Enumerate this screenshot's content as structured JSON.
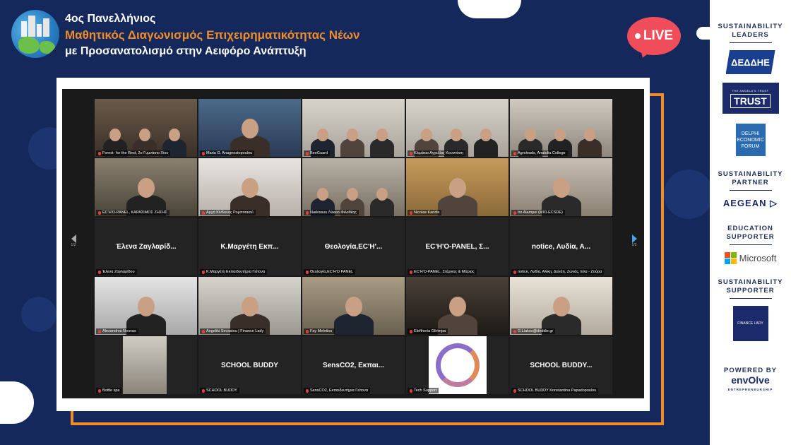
{
  "header": {
    "line1": "4ος Πανελλήνιος",
    "line2": "Μαθητικός Διαγωνισμός Επιχειρηματικότητας Νέων",
    "line3": "με Προσανατολισμό στην Αειφόρο Ανάπτυξη"
  },
  "live_badge": "LIVE",
  "zoom": {
    "page_left": "1/2",
    "page_right": "1/2",
    "tiles": [
      {
        "name": "Forest- for the Rest, 2ο Γυμνάσιο Χίου",
        "type": "video",
        "scene": "classroom"
      },
      {
        "name": "Maria G. Anagnostopoulou",
        "type": "video",
        "scene": "envolve-stage"
      },
      {
        "name": "BeeGuard",
        "type": "video",
        "scene": "group",
        "active": true
      },
      {
        "name": "Κλιμάκιο Αγγελίας Κουστάση",
        "type": "video",
        "scene": "group"
      },
      {
        "name": "Agroleads, Anatolia College",
        "type": "video",
        "scene": "room"
      },
      {
        "name": "ΕC'H'O-PANEL, ΚΑΡΑΣΙΜΟΣ ΖΗΣΗΣ",
        "type": "video",
        "scene": "office"
      },
      {
        "name": "Αρχή Κίνδυνος Ρομποτικού",
        "type": "video",
        "scene": "envolve-woman"
      },
      {
        "name": "Narkissus Λύκειο Φιλοθέης",
        "type": "video",
        "scene": "students"
      },
      {
        "name": "Nicolas Karidis",
        "type": "video",
        "scene": "man"
      },
      {
        "name": "Iro Alampei (MIO-ECSDE)",
        "type": "video",
        "scene": "woman"
      },
      {
        "name": "Έλενα Ζαγλαρίδου",
        "type": "name",
        "display": "Έλενα Ζαγλαρίδ..."
      },
      {
        "name": "Κ.Μαργέτη Εκπαιδευτήρια Γείτονα",
        "type": "name",
        "display": "Κ.Μαργέτη Εκπ..."
      },
      {
        "name": "Θεολογία,EC'H'O PANEL",
        "type": "name",
        "display": "Θεολογία,EC'H'..."
      },
      {
        "name": "EC'H'O-PANEL, Στέργιος & Μάριος",
        "type": "name",
        "display": "EC'H'O-PANEL, Σ..."
      },
      {
        "name": "notice, Λυδία, Αλίκη, Δανάη, Ζωνάς, Ελα - Ζούρα",
        "type": "name",
        "display": "notice, Λυδία, Α..."
      },
      {
        "name": "Alexandros Nouvas",
        "type": "video",
        "scene": "envolve-man"
      },
      {
        "name": "Angeliki Sevastou | Finance Lady",
        "type": "video",
        "scene": "woman-red"
      },
      {
        "name": "Fay Meletiou",
        "type": "video",
        "scene": "woman-blonde"
      },
      {
        "name": "Eleftheria Glirimpa",
        "type": "video",
        "scene": "dark"
      },
      {
        "name": "G.Liakos@deddie.gr",
        "type": "video",
        "scene": "man-suit"
      },
      {
        "name": "Bottle spa",
        "type": "video",
        "scene": "small"
      },
      {
        "name": "SCHOOL BUDDY",
        "type": "name",
        "display": "SCHOOL BUDDY"
      },
      {
        "name": "SensCO2, Εκπαιδευτήρια Γείτονα",
        "type": "name",
        "display": "SensCO2, Εκπαι..."
      },
      {
        "name": "Tech Support",
        "type": "ring"
      },
      {
        "name": "SCHOOL BUDDY Konstantina Papadopoulou",
        "type": "name",
        "display": "SCHOOL BUDDY..."
      }
    ]
  },
  "sidebar": {
    "sustainability_leaders": "SUSTAINABILITY\nLEADERS",
    "deddie": "ΔΕΔΔΗΕ",
    "trust_small": "THE ANGELA'S TRUST",
    "trust_big": "TRUST",
    "delphi": "DELPHI ECONOMIC FORUM",
    "sustainability_partner": "SUSTAINABILITY\nPARTNER",
    "aegean": "AEGEAN",
    "education_supporter": "EDUCATION\nSUPPORTER",
    "microsoft": "Microsoft",
    "sustainability_supporter": "SUSTAINABILITY\nSUPPORTER",
    "financelady": "FINANCE LADY",
    "powered_by": "POWERED BY",
    "envolve": "envOlve",
    "envolve_sub": "ENTREPRENEURSHIP"
  }
}
